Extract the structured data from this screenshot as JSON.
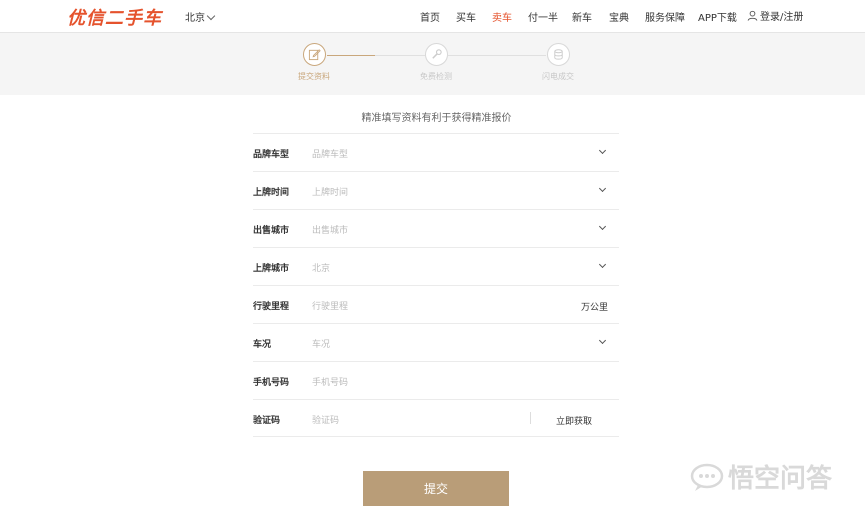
{
  "header": {
    "logo": "优信二手车",
    "city": "北京",
    "nav": [
      "首页",
      "买车",
      "卖车",
      "付一半",
      "新车",
      "宝典",
      "服务保障",
      "APP下载"
    ],
    "active_nav": "卖车",
    "login": "登录/注册"
  },
  "steps": [
    {
      "label": "提交资料",
      "icon": "edit-icon",
      "state": "active"
    },
    {
      "label": "免费检测",
      "icon": "wrench-icon",
      "state": "inactive"
    },
    {
      "label": "闪电成交",
      "icon": "coins-icon",
      "state": "inactive"
    }
  ],
  "subtitle": "精准填写资料有利于获得精准报价",
  "form": {
    "rows": [
      {
        "label": "品牌车型",
        "placeholder": "品牌车型",
        "type": "select"
      },
      {
        "label": "上牌时间",
        "placeholder": "上牌时间",
        "type": "select"
      },
      {
        "label": "出售城市",
        "placeholder": "出售城市",
        "type": "select"
      },
      {
        "label": "上牌城市",
        "placeholder": "北京",
        "type": "select"
      },
      {
        "label": "行驶里程",
        "placeholder": "行驶里程",
        "type": "unit",
        "unit": "万公里"
      },
      {
        "label": "车况",
        "placeholder": "车况",
        "type": "select"
      },
      {
        "label": "手机号码",
        "placeholder": "手机号码",
        "type": "text"
      },
      {
        "label": "验证码",
        "placeholder": "验证码",
        "type": "code",
        "action": "立即获取"
      }
    ]
  },
  "submit_label": "提交",
  "watermark": "悟空问答",
  "colors": {
    "brand": "#e5532d",
    "accent": "#c9a77c",
    "button": "#b99d78"
  }
}
